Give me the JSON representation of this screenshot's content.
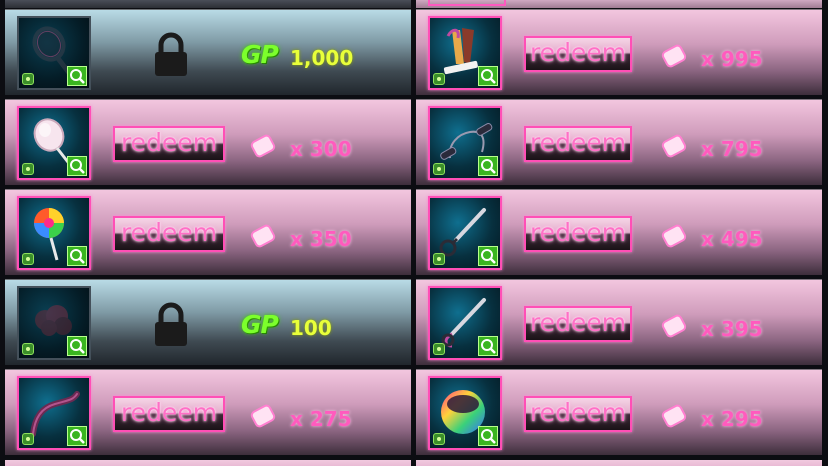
{
  "colors": {
    "accent_pink": "#ff4fb6",
    "gp_green": "#7cff2c",
    "gp_price_yellow": "#e8ff3a",
    "quantity_pink": "#ff5bbe"
  },
  "left_column": [
    {
      "state": "locked",
      "item_icon": "racket-icon",
      "currency_label": "GP",
      "price": "1,000"
    },
    {
      "state": "redeem",
      "item_icon": "lollipop-white-icon",
      "button_label": "redeem",
      "cost": "x 300"
    },
    {
      "state": "redeem",
      "item_icon": "swirl-lollipop-icon",
      "button_label": "redeem",
      "cost": "x 350"
    },
    {
      "state": "locked",
      "item_icon": "cloud-blob-icon",
      "currency_label": "GP",
      "price": "100"
    },
    {
      "state": "redeem",
      "item_icon": "streamer-icon",
      "button_label": "redeem",
      "cost": "x 275"
    }
  ],
  "right_column": [
    {
      "state": "redeem",
      "item_icon": "ribbon-bundle-icon",
      "button_label": "redeem",
      "cost": "x 995"
    },
    {
      "state": "redeem",
      "item_icon": "jump-rope-icon",
      "button_label": "redeem",
      "cost": "x 795"
    },
    {
      "state": "redeem",
      "item_icon": "wand-loop-icon",
      "button_label": "redeem",
      "cost": "x 495"
    },
    {
      "state": "redeem",
      "item_icon": "ribbon-stick-icon",
      "button_label": "redeem",
      "cost": "x 395"
    },
    {
      "state": "redeem",
      "item_icon": "rainbow-ball-icon",
      "button_label": "redeem",
      "cost": "x 295"
    }
  ]
}
